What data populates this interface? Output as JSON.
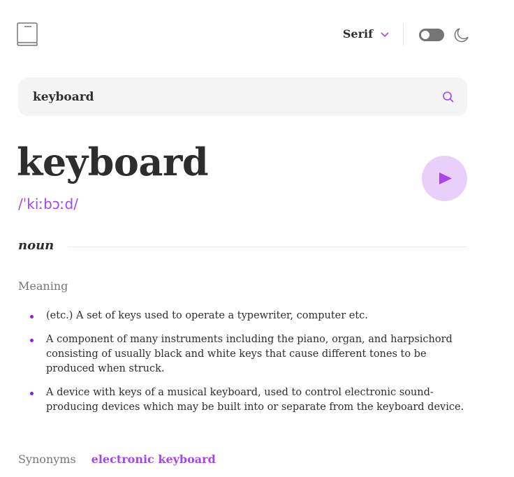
{
  "header": {
    "logo_icon": "book-icon",
    "font_select": {
      "value": "Serif",
      "icon": "chevron-down-icon"
    },
    "theme_toggle": {
      "state": "off",
      "icon": "moon-icon"
    }
  },
  "search": {
    "value": "keyboard",
    "icon": "search-icon"
  },
  "entry": {
    "word": "keyboard",
    "phonetic": "/ˈkiːbɔːd/",
    "play_icon": "play-icon",
    "part_of_speech": "noun",
    "meaning_heading": "Meaning",
    "meanings": [
      "(etc.) A set of keys used to operate a typewriter, computer etc.",
      "A component of many instruments including the piano, organ, and harpsichord consisting of usually black and white keys that cause different tones to be produced when struck.",
      "A device with keys of a musical keyboard, used to control electronic sound-producing devices which may be built into or separate from the keyboard device."
    ],
    "synonyms_label": "Synonyms",
    "synonyms": [
      "electronic keyboard"
    ]
  },
  "colors": {
    "accent": "#a445ed",
    "accent_light": "#e9d0fa",
    "muted": "#757575",
    "text": "#2d2d2d",
    "search_bg": "#f4f4f4"
  }
}
